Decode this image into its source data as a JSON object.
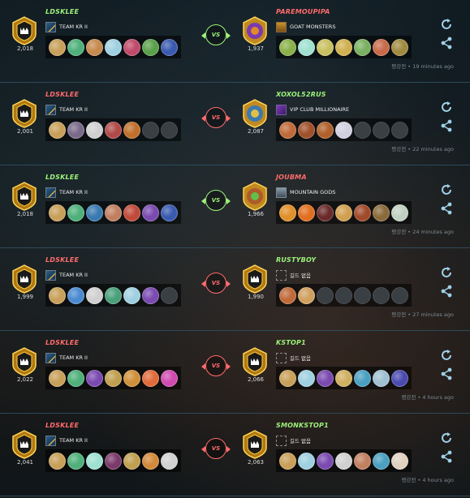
{
  "labels": {
    "vs": "VS"
  },
  "colors": {
    "win": "#9cf37a",
    "loss": "#ff6b6b",
    "row_border": "#2e4a5a"
  },
  "icons": {
    "rematch": "refresh-icon",
    "share": "share-icon"
  },
  "matches": [
    {
      "result": "win",
      "left": {
        "name": "LDSKLEE",
        "status": "win",
        "rating": "2,018",
        "guild": "TEAM KR II",
        "guild_style": "kr",
        "units": [
          "#c8a05a",
          "#4fb07a",
          "#c68a4e",
          "#9fd0e0",
          "#c04a6a",
          "#5aa04a",
          "#3a5ab0"
        ]
      },
      "right": {
        "name": "PAREMOUPIPA",
        "status": "loss",
        "rating": "1,937",
        "guild": "GOAT MONSTERS",
        "guild_style": "goat",
        "units": [
          "#8ab04a",
          "#9fe0d0",
          "#c8c060",
          "#d0b050",
          "#7ab060",
          "#c86a4a",
          "#a08a40"
        ]
      },
      "time": "평강전 • 19 minutes ago"
    },
    {
      "result": "loss",
      "left": {
        "name": "LDSKLEE",
        "status": "loss",
        "rating": "2,001",
        "guild": "TEAM KR II",
        "guild_style": "kr",
        "units": [
          "#c8a05a",
          "#7a6a8a",
          "#d0d0d0",
          "#b04a4a",
          "#c0702a",
          "empty",
          "empty"
        ]
      },
      "right": {
        "name": "XOXOL52RUS",
        "status": "win",
        "rating": "2,087",
        "guild": "VIP CLUB MILLIONAIRE",
        "guild_style": "vip",
        "units": [
          "#c06a3a",
          "#a0502a",
          "#b0602a",
          "#d0d0e0",
          "empty",
          "empty",
          "empty"
        ]
      },
      "time": "평강전 • 22 minutes ago"
    },
    {
      "result": "win",
      "left": {
        "name": "LDSKLEE",
        "status": "win",
        "rating": "2,018",
        "guild": "TEAM KR II",
        "guild_style": "kr",
        "units": [
          "#c8a05a",
          "#4fb07a",
          "#3a7ab0",
          "#c08060",
          "#c04a3a",
          "#7a4ab0",
          "#3a5ab0"
        ]
      },
      "right": {
        "name": "JOUBMA",
        "status": "loss",
        "rating": "1,966",
        "guild": "MOUNTAIN GODS",
        "guild_style": "mtn",
        "units": [
          "#e0902a",
          "#e07020",
          "#6a2a2a",
          "#d0a050",
          "#a04a2a",
          "#8a6a3a",
          "#c0d0c0"
        ]
      },
      "time": "평강전 • 24 minutes ago"
    },
    {
      "result": "loss",
      "left": {
        "name": "LDSKLEE",
        "status": "loss",
        "rating": "1,999",
        "guild": "TEAM KR II",
        "guild_style": "kr",
        "units": [
          "#c8a05a",
          "#4a8ad0",
          "#d0d0d0",
          "#4aa07a",
          "#9fd0e0",
          "#7a4ab0",
          "empty"
        ]
      },
      "right": {
        "name": "RUSTYBOY",
        "status": "win",
        "rating": "1,990",
        "guild": "길드 없음",
        "guild_style": "none",
        "units": [
          "#c06a3a",
          "#d0a060",
          "empty",
          "empty",
          "empty",
          "empty",
          "empty"
        ]
      },
      "time": "평강전 • 27 minutes ago"
    },
    {
      "result": "loss",
      "left": {
        "name": "LDSKLEE",
        "status": "loss",
        "rating": "2,022",
        "guild": "TEAM KR II",
        "guild_style": "kr",
        "units": [
          "#c8a05a",
          "#4fb07a",
          "#7a4ab0",
          "#c0a050",
          "#d0903a",
          "#e06a3a",
          "#d04ab0"
        ]
      },
      "right": {
        "name": "KSTOP1",
        "status": "win",
        "rating": "2,066",
        "guild": "길드 없음",
        "guild_style": "none",
        "units": [
          "#c8a05a",
          "#9fd0e0",
          "#7a4ab0",
          "#d0b060",
          "#4aa0c0",
          "#a0c0d0",
          "#4a4ab0"
        ]
      },
      "time": "평강전 • 4 hours ago"
    },
    {
      "result": "loss",
      "left": {
        "name": "LDSKLEE",
        "status": "loss",
        "rating": "2,041",
        "guild": "TEAM KR II",
        "guild_style": "kr",
        "units": [
          "#c8a05a",
          "#4fb07a",
          "#9fe0d0",
          "#7a3a6a",
          "#c0a050",
          "#d08a3a",
          "#d0d0d0"
        ]
      },
      "right": {
        "name": "SMONKSTOP1",
        "status": "win",
        "rating": "2,063",
        "guild": "길드 없음",
        "guild_style": "none",
        "units": [
          "#c8a05a",
          "#9fd0e0",
          "#7a4ab0",
          "#d0d0d0",
          "#c08060",
          "#4aa0c0",
          "#e0d0c0"
        ]
      },
      "time": "평강전 • 4 hours ago"
    }
  ]
}
